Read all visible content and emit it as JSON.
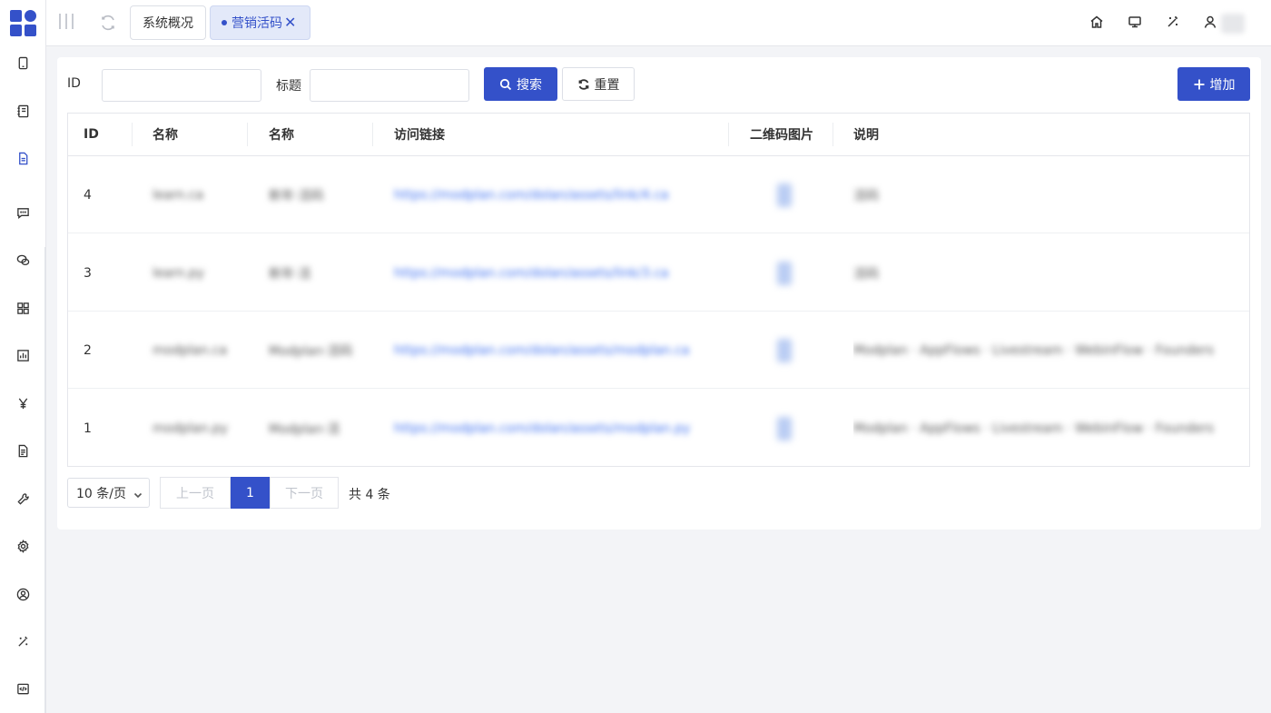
{
  "header": {
    "tabs": [
      {
        "label": "系统概况"
      },
      {
        "label": "营销活码"
      }
    ],
    "tab_close_glyph": "✕"
  },
  "sidebar": {
    "icons": [
      "tablet-icon",
      "notebook-icon",
      "document-icon",
      "message-icon",
      "wechat-icon",
      "grid-icon",
      "bar-chart-icon",
      "yen-icon",
      "file-text-icon",
      "wrench-icon",
      "settings-icon",
      "user-circle-icon",
      "magic-wand-icon",
      "code-icon"
    ]
  },
  "filters": {
    "id_label": "ID",
    "title_label": "标题",
    "id_value": "",
    "title_value": "",
    "search_label": "搜索",
    "reset_label": "重置",
    "add_label": "增加"
  },
  "table": {
    "columns": [
      "ID",
      "名称",
      "名称",
      "访问链接",
      "二维码图片",
      "说明"
    ],
    "rows": [
      {
        "id": "4",
        "name": "learn.ca",
        "name2": "新年·活码",
        "link": "https://modplan.com/dolan/assets/link/4.ca",
        "desc": "活码"
      },
      {
        "id": "3",
        "name": "learn.py",
        "name2": "新年·活",
        "link": "https://modplan.com/dolan/assets/link/3.ca",
        "desc": "活码"
      },
      {
        "id": "2",
        "name": "modplan.ca",
        "name2": "Modplan·活码",
        "link": "https://modplan.com/dolan/assets/modplan.ca",
        "desc": "Modplan · AppFlows · Livestream · WebinFlow · Founders"
      },
      {
        "id": "1",
        "name": "modplan.py",
        "name2": "Modplan·活",
        "link": "https://modplan.com/dolan/assets/modplan.py",
        "desc": "Modplan · AppFlows · Livestream · WebinFlow · Founders"
      }
    ]
  },
  "pagination": {
    "page_size_label": "10 条/页",
    "prev_label": "上一页",
    "current_page": "1",
    "next_label": "下一页",
    "total_label": "共 4 条"
  },
  "colors": {
    "accent": "#3451c9",
    "link": "#3c6ff0",
    "page_bg": "#f3f4f7"
  }
}
